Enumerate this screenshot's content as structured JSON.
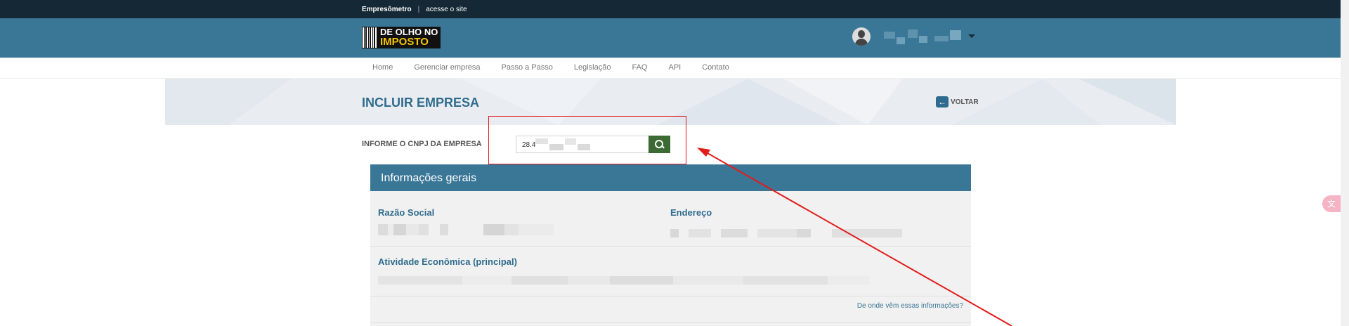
{
  "topbar": {
    "brand": "Empresômetro",
    "separator": "|",
    "link": "acesse o site"
  },
  "header": {
    "logo": {
      "line1": "DE OLHO NO",
      "line2": "IMPOSTO"
    },
    "avatar_icon": "user-avatar-icon",
    "caret_icon": "chevron-down-icon"
  },
  "nav": [
    "Home",
    "Gerenciar empresa",
    "Passo a Passo",
    "Legislação",
    "FAQ",
    "API",
    "Contato"
  ],
  "page": {
    "title": "INCLUIR EMPRESA",
    "back_label": "VOLTAR",
    "back_icon": "arrow-left-icon"
  },
  "search": {
    "label": "INFORME O CNPJ DA EMPRESA",
    "value": "28.4",
    "button_icon": "search-icon"
  },
  "panel": {
    "header": "Informações gerais",
    "razao_label": "Razão Social",
    "endereco_label": "Endereço",
    "atividade_label": "Atividade Econômica (principal)",
    "origin_link": "De onde vêm essas informações?"
  },
  "side_widget_icon": "translate-icon",
  "colors": {
    "topbar": "#142935",
    "header": "#3a7797",
    "title": "#2f6c8d",
    "search_button": "#3b6a33",
    "annotation": "#e21b1b"
  }
}
